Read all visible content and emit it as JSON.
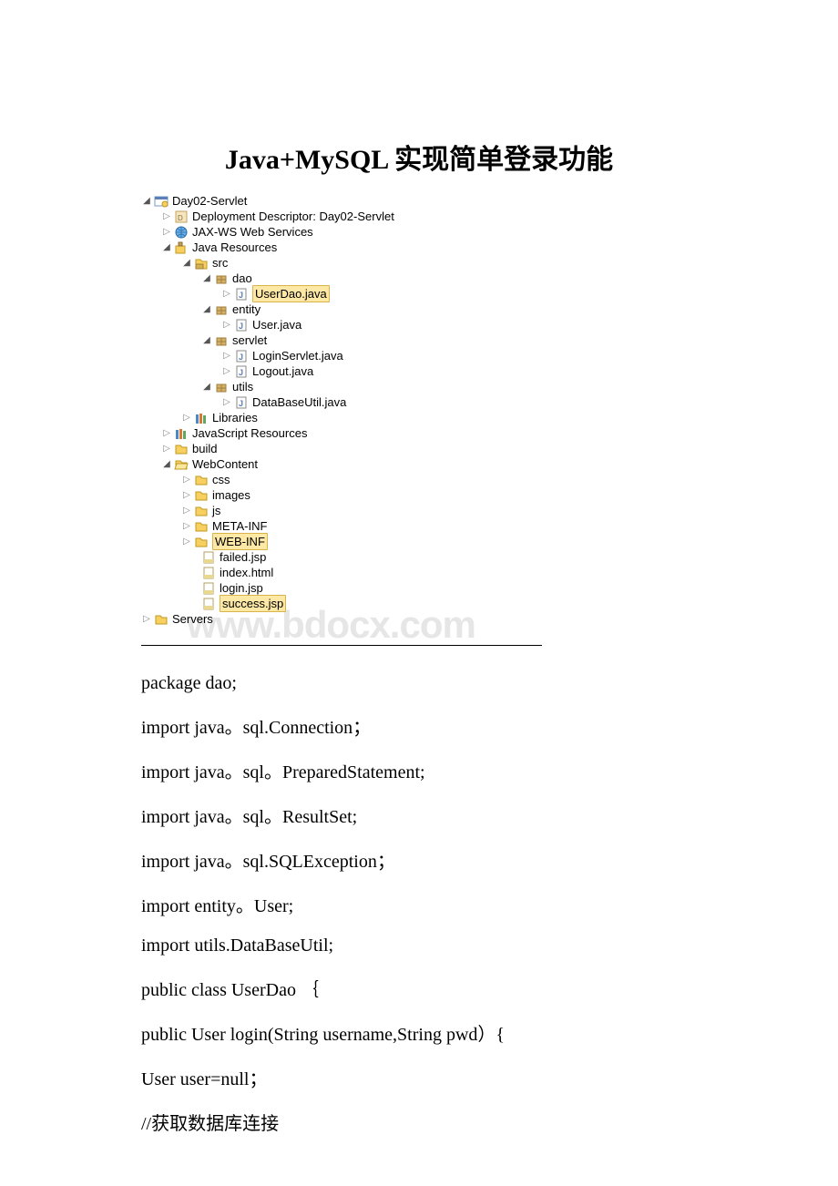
{
  "title": "Java+MySQL 实现简单登录功能",
  "watermark": "www.bdocx.com",
  "tree": {
    "root": "Day02-Servlet",
    "deploy": "Deployment Descriptor: Day02-Servlet",
    "jaxws": "JAX-WS Web Services",
    "javaRes": "Java Resources",
    "src": "src",
    "dao": "dao",
    "userDao": "UserDao.java",
    "entity": "entity",
    "userJava": "User.java",
    "servlet": "servlet",
    "loginServlet": "LoginServlet.java",
    "logout": "Logout.java",
    "utils": "utils",
    "dbUtil": "DataBaseUtil.java",
    "libraries": "Libraries",
    "jsRes": "JavaScript Resources",
    "build": "build",
    "webContent": "WebContent",
    "css": "css",
    "images": "images",
    "js": "js",
    "metaInf": "META-INF",
    "webInf": "WEB-INF",
    "failed": "failed.jsp",
    "indexHtml": "index.html",
    "loginJsp": "login.jsp",
    "successJsp": "success.jsp",
    "servers": "Servers"
  },
  "code": {
    "l1": "package dao;",
    "l2": "import java。sql.Connection；",
    "l3": "import java。sql。PreparedStatement;",
    "l4": "import java。sql。ResultSet;",
    "l5": "import java。sql.SQLException；",
    "l6": "import entity。User;",
    "l7": "import utils.DataBaseUtil;",
    "l8": "public class UserDao ｛",
    "l9": " public User login(String username,String pwd）{",
    "l10": "  User user=null；",
    "l11": "  //获取数据库连接"
  }
}
